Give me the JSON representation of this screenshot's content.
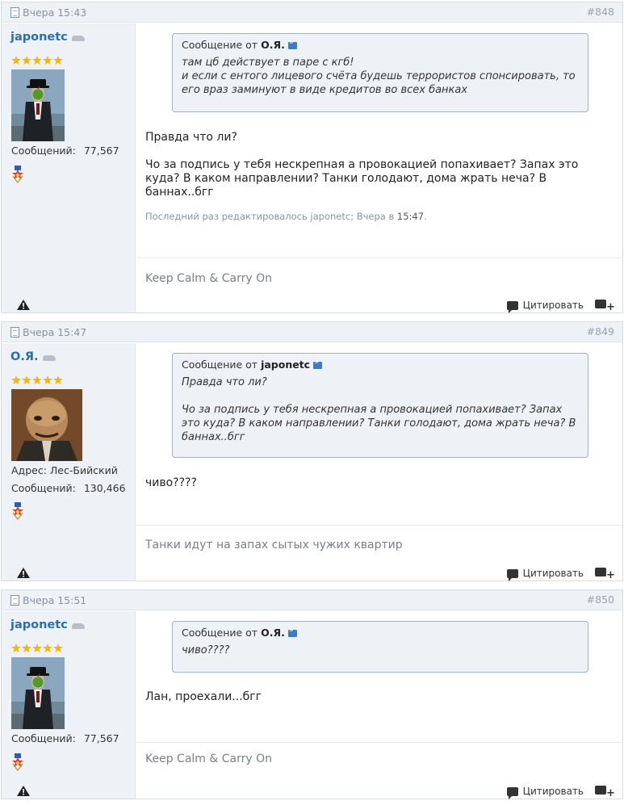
{
  "posts": [
    {
      "date": "Вчера 15:43",
      "number": "#848",
      "author": "japonetc",
      "avatar_kind": "bowler-hat-apple-painting",
      "stats": [
        {
          "label": "Сообщений:",
          "value": "77,567"
        }
      ],
      "quote_prefix": "Сообщение от",
      "quote_author": "О.Я.",
      "quote_text": "там цб действует в паре с кгб!\nи если с ентого лицевого счёта будешь террористов спонсировать, то его враз заминуют в виде кредитов во всех банках",
      "message": "Правда что ли?\n\nЧо за подпись у тебя нескрепная а провокацией попахивает? Запах это куда? В каком направлении? Танки голодают, дома жрать неча? В баннах..бгг",
      "edited_prefix": "Последний раз редактировалось japonetc; Вчера в",
      "edited_time": "15:47",
      "edited_suffix": ".",
      "signature": "Keep Calm & Carry On",
      "quote_button": "Цитировать"
    },
    {
      "date": "Вчера 15:47",
      "number": "#849",
      "author": "О.Я.",
      "avatar_kind": "grotesque-portrait",
      "stats": [
        {
          "label": "Адрес:",
          "value": "Лес-Бийский"
        },
        {
          "label": "Сообщений:",
          "value": "130,466"
        }
      ],
      "quote_prefix": "Сообщение от",
      "quote_author": "japonetc",
      "quote_text": "Правда что ли?\n\nЧо за подпись у тебя нескрепная а провокацией попахивает? Запах это куда? В каком направлении? Танки голодают, дома жрать неча? В баннах..бгг",
      "message": "чиво????",
      "signature": "Танки идут на запах сытых чужих квартир",
      "quote_button": "Цитировать"
    },
    {
      "date": "Вчера 15:51",
      "number": "#850",
      "author": "japonetc",
      "avatar_kind": "bowler-hat-apple-painting",
      "stats": [
        {
          "label": "Сообщений:",
          "value": "77,567"
        }
      ],
      "quote_prefix": "Сообщение от",
      "quote_author": "О.Я.",
      "quote_text": "чиво????",
      "message": "Лан, проехали...бгг",
      "signature": "Keep Calm & Carry On",
      "quote_button": "Цитировать"
    }
  ],
  "icons": {
    "date": "document-icon",
    "car": "car-icon",
    "rank": "star-icon",
    "medal": "medal-icon",
    "report": "warning-icon",
    "quote": "quote-bubble-icon",
    "multiquote": "multiquote-plus-icon",
    "goto": "go-to-post-icon"
  },
  "colors": {
    "username": "#2a6fb3",
    "header_bg": "#eef1f6",
    "quote_bg": "#eef2f7",
    "quote_border": "#9fb3c6",
    "star": "#f2b705"
  }
}
